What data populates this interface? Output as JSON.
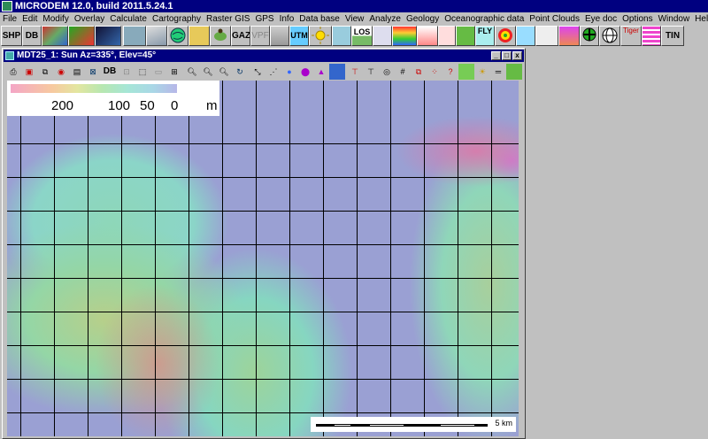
{
  "app": {
    "title": "MICRODEM 12.0, build 2011.5.24.1"
  },
  "menu": [
    "File",
    "Edit",
    "Modify",
    "Overlay",
    "Calculate",
    "Cartography",
    "Raster GIS",
    "GPS",
    "Info",
    "Data base",
    "View",
    "Analyze",
    "Geology",
    "Oceanographic data",
    "Point Clouds",
    "Eye doc",
    "Options",
    "Window",
    "Help"
  ],
  "toolbar": {
    "shp": "SHP",
    "db": "DB",
    "gaz": "GAZ",
    "vpf": "VPF",
    "utm": "UTM",
    "los": "LOS",
    "tin": "TIN",
    "fly": "FLY",
    "tiger": "Tiger"
  },
  "child_window": {
    "title": "MDT25_1: Sun Az=335°, Elev=45°",
    "db_label": "DB",
    "minimize": "_",
    "restore": "□",
    "close": "x"
  },
  "legend": {
    "labels": [
      "200",
      "100",
      "50",
      "0"
    ],
    "unit": "m"
  },
  "scalebar": {
    "label": "5 km"
  },
  "colors": {
    "title_bar": "#000080",
    "map_water": "#9aa0d3",
    "chrome": "#c0c0c0"
  }
}
